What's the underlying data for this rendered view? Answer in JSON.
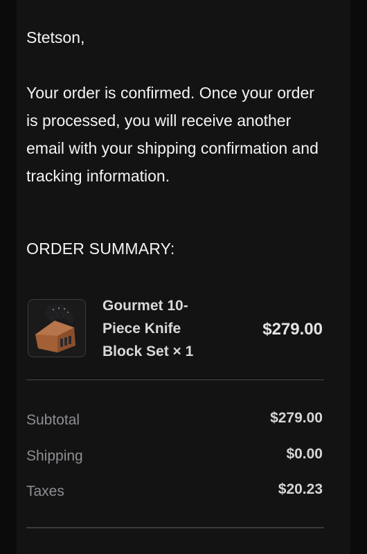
{
  "email": {
    "greeting": "Stetson,",
    "message": "Your order is confirmed. Once your order is processed, you will receive another email with your shipping confirmation and tracking information.",
    "summary_heading": "ORDER SUMMARY:"
  },
  "order": {
    "items": [
      {
        "name": "Gourmet 10-Piece Knife Block Set × 1",
        "price": "$279.00",
        "image_icon": "knife-block-image"
      }
    ],
    "totals": {
      "subtotal_label": "Subtotal",
      "subtotal_value": "$279.00",
      "shipping_label": "Shipping",
      "shipping_value": "$0.00",
      "taxes_label": "Taxes",
      "taxes_value": "$20.23"
    }
  },
  "colors": {
    "background": "#0b0b0c",
    "panel": "#131314",
    "text_primary": "#f4f4f4",
    "text_muted": "#8f8f93",
    "divider": "#48484a",
    "knife_block_wood": "#a8643a"
  }
}
